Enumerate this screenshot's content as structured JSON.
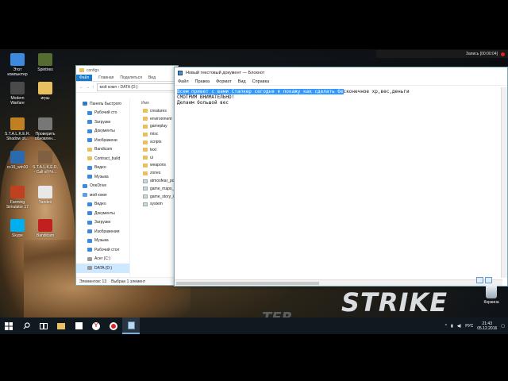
{
  "desktop": {
    "icons": [
      {
        "label": "Этот компьютер",
        "color": "#3c8ae0"
      },
      {
        "label": "Spintires",
        "color": "#556b2f"
      },
      {
        "label": "Modern Warfare",
        "color": "#4a4a4a"
      },
      {
        "label": "игры",
        "color": "#e8c060"
      },
      {
        "label": "S.T.A.L.K.E.R. Shadow of...",
        "color": "#c08020"
      },
      {
        "label": "Проверить обновлен...",
        "color": "#777777"
      },
      {
        "label": "cs16_win10",
        "color": "#2a6ab0"
      },
      {
        "label": "S.T.A.L.K.E.R. - Call of Pri...",
        "color": "#806040"
      },
      {
        "label": "Farming Simulator 17",
        "color": "#c04020"
      },
      {
        "label": "Yandex",
        "color": "#e8e8e8"
      },
      {
        "label": "Skype",
        "color": "#00aff0"
      },
      {
        "label": "Bandicam",
        "color": "#c02020"
      }
    ],
    "wallpaper_text_main": "STRIKE",
    "wallpaper_text_small": "TER",
    "recycle_bin_label": "Корзина"
  },
  "recording": {
    "label": "Запись [00:00:04]"
  },
  "explorer": {
    "title": "configs",
    "ribbon": [
      "Файл",
      "Главная",
      "Поделиться",
      "Вид"
    ],
    "path_parts": [
      "мой комп",
      "DATA (D:)"
    ],
    "nav_items": [
      {
        "label": "Панель быстрого",
        "icon": "star",
        "level": "top"
      },
      {
        "label": "Рабочий сто",
        "icon": "blue",
        "level": "sub"
      },
      {
        "label": "Загрузки",
        "icon": "blue",
        "level": "sub"
      },
      {
        "label": "Документы",
        "icon": "blue",
        "level": "sub"
      },
      {
        "label": "Изображени",
        "icon": "blue",
        "level": "sub"
      },
      {
        "label": "Bandicam",
        "icon": "folder",
        "level": "sub"
      },
      {
        "label": "Contract_build",
        "icon": "folder",
        "level": "sub"
      },
      {
        "label": "Видео",
        "icon": "blue",
        "level": "sub"
      },
      {
        "label": "Музыка",
        "icon": "blue",
        "level": "sub"
      },
      {
        "label": "OneDrive",
        "icon": "blue",
        "level": "top"
      },
      {
        "label": "мой комп",
        "icon": "pc",
        "level": "top"
      },
      {
        "label": "Видео",
        "icon": "blue",
        "level": "sub"
      },
      {
        "label": "Документы",
        "icon": "blue",
        "level": "sub"
      },
      {
        "label": "Загрузки",
        "icon": "blue",
        "level": "sub"
      },
      {
        "label": "Изображения",
        "icon": "blue",
        "level": "sub"
      },
      {
        "label": "Музыка",
        "icon": "blue",
        "level": "sub"
      },
      {
        "label": "Рабочий стол",
        "icon": "blue",
        "level": "sub"
      },
      {
        "label": "Acer (C:)",
        "icon": "drive",
        "level": "sub"
      },
      {
        "label": "DATA (D:)",
        "icon": "drive",
        "level": "sub",
        "selected": true
      }
    ],
    "files_header": "Имя",
    "files": [
      {
        "name": "creatures",
        "type": "folder"
      },
      {
        "name": "environment",
        "type": "folder"
      },
      {
        "name": "gameplay",
        "type": "folder"
      },
      {
        "name": "misc",
        "type": "folder"
      },
      {
        "name": "scripts",
        "type": "folder"
      },
      {
        "name": "text",
        "type": "folder"
      },
      {
        "name": "ui",
        "type": "folder"
      },
      {
        "name": "weapons",
        "type": "folder"
      },
      {
        "name": "zones",
        "type": "folder"
      },
      {
        "name": "atmosfear_pc",
        "type": "file"
      },
      {
        "name": "game_maps_s",
        "type": "file"
      },
      {
        "name": "game_story_i",
        "type": "file"
      },
      {
        "name": "system",
        "type": "file"
      }
    ],
    "status_count": "Элементов: 13",
    "status_selected": "Выбран 1 элемент"
  },
  "notepad": {
    "title": "Новый текстовый документ — Блокнот",
    "menu": [
      "Файл",
      "Правка",
      "Формат",
      "Вид",
      "Справка"
    ],
    "line1_selected": "Всем привет с вами Сталкер сегодня я покажу как сделать бе",
    "line1_rest": "сконечное хр,вес,деньги",
    "line2": "СМОТРИМ ВНИМАТЕЛЬНО!",
    "line3": "Делаем большой вес"
  },
  "taskbar": {
    "language": "РУС",
    "time": "21:43",
    "date": "05.12.2016"
  },
  "colors": {
    "accent": "#1979ca",
    "selection": "#3399ff",
    "taskbar": "#101820"
  }
}
